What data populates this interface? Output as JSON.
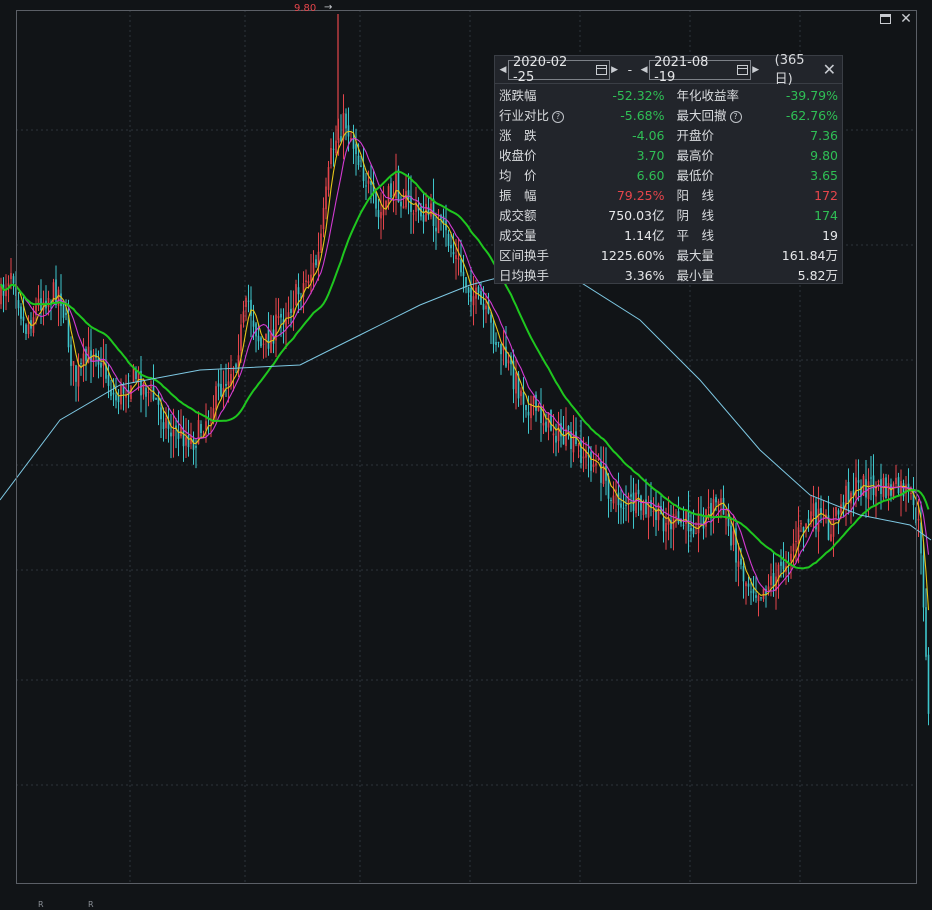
{
  "chart_data": {
    "type": "candlestick",
    "peak_label": "9.80",
    "bottom_marks": [
      "R",
      "R"
    ],
    "colors": {
      "up": "#e5454b",
      "down": "#3ec6cc",
      "ma_yellow": "#e6c619",
      "ma_magenta": "#d33ad3",
      "ma_green": "#1fc71f",
      "ma_cyan": "#7ec8e3",
      "grid": "#2d333b"
    }
  },
  "window_controls": {
    "maximize_icon": "maximize-icon",
    "close_icon": "close-icon"
  },
  "stats": {
    "start_date": "2020-02 -25",
    "separator": "-",
    "end_date": "2021-08 -19",
    "days": "(365日)",
    "rows": [
      {
        "l_label": "涨跌幅",
        "l_value": "-52.32%",
        "l_color": "green",
        "l_help": false,
        "r_label": "年化收益率",
        "r_value": "-39.79%",
        "r_color": "green",
        "r_help": false
      },
      {
        "l_label": "行业对比",
        "l_value": "-5.68%",
        "l_color": "green",
        "l_help": true,
        "r_label": "最大回撤",
        "r_value": "-62.76%",
        "r_color": "green",
        "r_help": true
      },
      {
        "l_label": "涨　跌",
        "l_value": "-4.06",
        "l_color": "green",
        "l_help": false,
        "r_label": "开盘价",
        "r_value": "7.36",
        "r_color": "green",
        "r_help": false
      },
      {
        "l_label": "收盘价",
        "l_value": "3.70",
        "l_color": "green",
        "l_help": false,
        "r_label": "最高价",
        "r_value": "9.80",
        "r_color": "green",
        "r_help": false
      },
      {
        "l_label": "均　价",
        "l_value": "6.60",
        "l_color": "green",
        "l_help": false,
        "r_label": "最低价",
        "r_value": "3.65",
        "r_color": "green",
        "r_help": false
      },
      {
        "l_label": "振　幅",
        "l_value": "79.25%",
        "l_color": "red",
        "l_help": false,
        "r_label": "阳　线",
        "r_value": "172",
        "r_color": "red",
        "r_help": false
      },
      {
        "l_label": "成交额",
        "l_value": "750.03亿",
        "l_color": "white",
        "l_help": false,
        "r_label": "阴　线",
        "r_value": "174",
        "r_color": "green",
        "r_help": false
      },
      {
        "l_label": "成交量",
        "l_value": "1.14亿",
        "l_color": "white",
        "l_help": false,
        "r_label": "平　线",
        "r_value": "19",
        "r_color": "white",
        "r_help": false
      },
      {
        "l_label": "区间换手",
        "l_value": "1225.60%",
        "l_color": "white",
        "l_help": false,
        "r_label": "最大量",
        "r_value": "161.84万",
        "r_color": "white",
        "r_help": false
      },
      {
        "l_label": "日均换手",
        "l_value": "3.36%",
        "l_color": "white",
        "l_help": false,
        "r_label": "最小量",
        "r_value": "5.82万",
        "r_color": "white",
        "r_help": false
      }
    ]
  }
}
